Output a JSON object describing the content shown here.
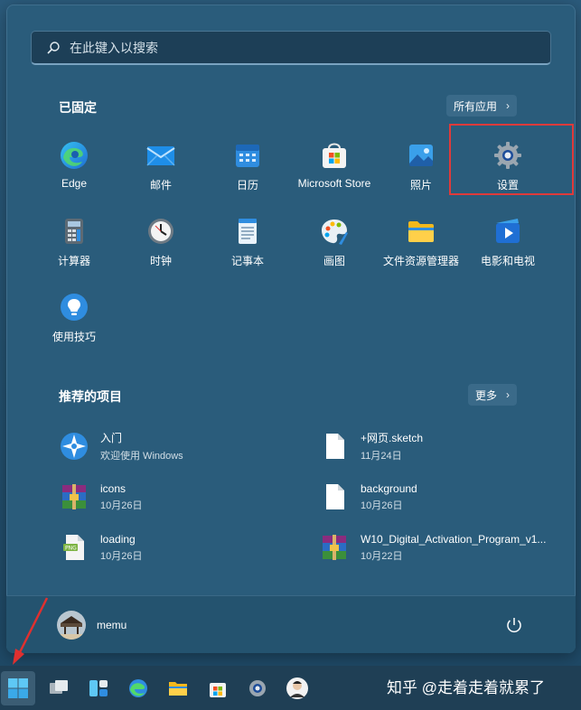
{
  "search": {
    "placeholder": "在此键入以搜索",
    "icon": "search-icon"
  },
  "pinned": {
    "title": "已固定",
    "all_apps_label": "所有应用",
    "apps": [
      {
        "label": "Edge",
        "icon": "edge-icon"
      },
      {
        "label": "邮件",
        "icon": "mail-icon"
      },
      {
        "label": "日历",
        "icon": "calendar-icon"
      },
      {
        "label": "Microsoft Store",
        "icon": "store-icon"
      },
      {
        "label": "照片",
        "icon": "photos-icon"
      },
      {
        "label": "设置",
        "icon": "settings-icon"
      },
      {
        "label": "计算器",
        "icon": "calculator-icon"
      },
      {
        "label": "时钟",
        "icon": "clock-icon"
      },
      {
        "label": "记事本",
        "icon": "notepad-icon"
      },
      {
        "label": "画图",
        "icon": "paint-icon"
      },
      {
        "label": "文件资源管理器",
        "icon": "folder-icon"
      },
      {
        "label": "电影和电视",
        "icon": "movies-icon"
      },
      {
        "label": "使用技巧",
        "icon": "tips-icon"
      }
    ]
  },
  "recommended": {
    "title": "推荐的项目",
    "more_label": "更多",
    "items": [
      {
        "name": "入门",
        "sub": "欢迎使用 Windows",
        "icon": "get-started-icon"
      },
      {
        "name": "+网页.sketch",
        "sub": "11月24日",
        "icon": "file-icon"
      },
      {
        "name": "icons",
        "sub": "10月26日",
        "icon": "winrar-archive-icon"
      },
      {
        "name": "background",
        "sub": "10月26日",
        "icon": "file-icon"
      },
      {
        "name": "loading",
        "sub": "10月26日",
        "icon": "png-file-icon"
      },
      {
        "name": "W10_Digital_Activation_Program_v1...",
        "sub": "10月22日",
        "icon": "winrar-archive-icon"
      }
    ]
  },
  "user": {
    "name": "memu"
  },
  "power": {
    "icon": "power-icon"
  },
  "taskbar": {
    "items": [
      "start-icon",
      "task-view-icon",
      "widgets-icon",
      "edge-icon",
      "file-explorer-icon",
      "store-icon",
      "settings-icon",
      "avatar-icon"
    ]
  },
  "watermark": "知乎 @走着走着就累了",
  "colors": {
    "highlight": "#e03a3a",
    "accent": "#2a5c7b"
  }
}
